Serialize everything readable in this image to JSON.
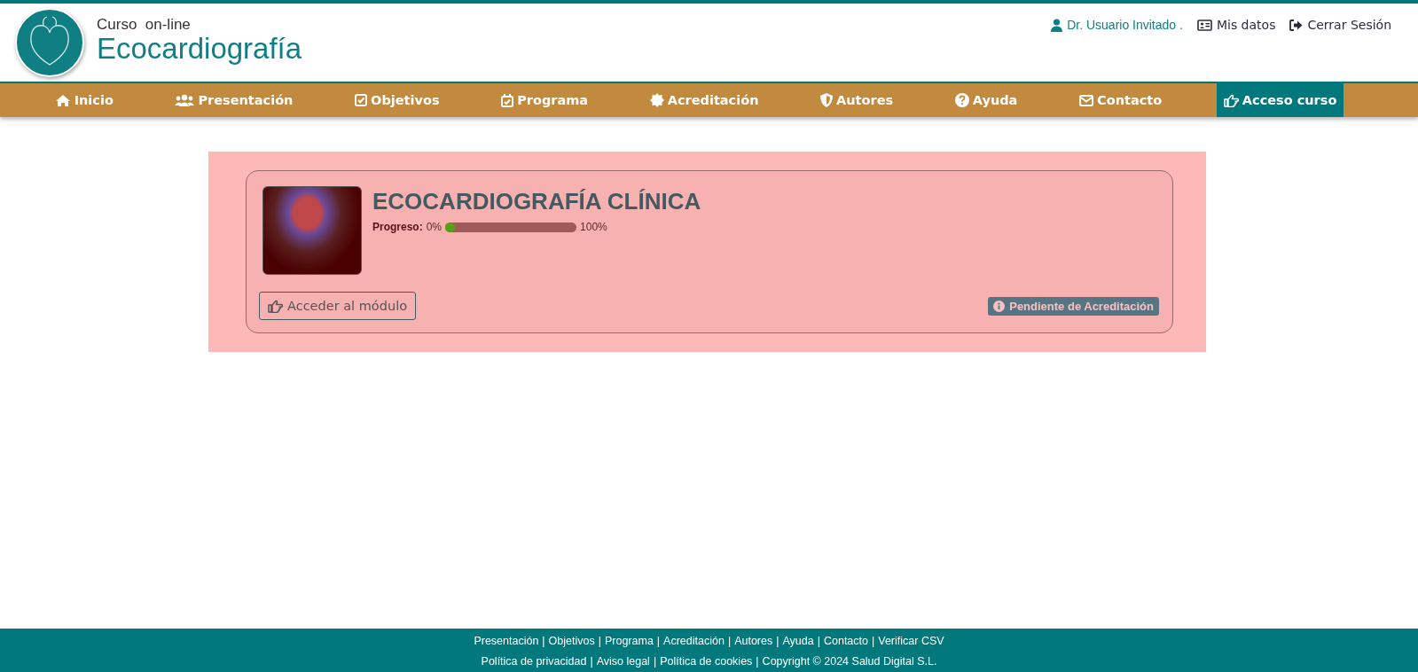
{
  "header": {
    "subtitle": "Curso  on-line",
    "title": "Ecocardiografía",
    "user": "Dr. Usuario Invitado .",
    "links": [
      {
        "label": "Mis datos"
      },
      {
        "label": "Cerrar Sesión"
      }
    ]
  },
  "nav": [
    {
      "label": "Inicio",
      "selected": false
    },
    {
      "label": "Presentación",
      "selected": false
    },
    {
      "label": "Objetivos",
      "selected": false
    },
    {
      "label": "Programa",
      "selected": false
    },
    {
      "label": "Acreditación",
      "selected": false
    },
    {
      "label": "Autores",
      "selected": false
    },
    {
      "label": "Ayuda",
      "selected": false
    },
    {
      "label": "Contacto",
      "selected": false
    },
    {
      "label": "Acceso curso",
      "selected": true
    }
  ],
  "course": {
    "title": "ECOCARDIOGRAFÍA CLÍNICA",
    "progress_label": "Progreso:",
    "progress_min": "0%",
    "progress_max": "100%",
    "level": 0.04,
    "button": "Acceder al módulo",
    "status": "Pendiente de Acreditación"
  },
  "footer": {
    "separator": "|",
    "site_links": [
      "Presentación",
      "Objetivos",
      "Programa",
      "Acreditación",
      "Autores",
      "Ayuda",
      "Contacto",
      "Verificar CSV"
    ],
    "legal_links": [
      "Política de privacidad",
      "Aviso legal",
      "Política de cookies",
      "Copyright © 2024 Salud Digital S.L."
    ]
  }
}
